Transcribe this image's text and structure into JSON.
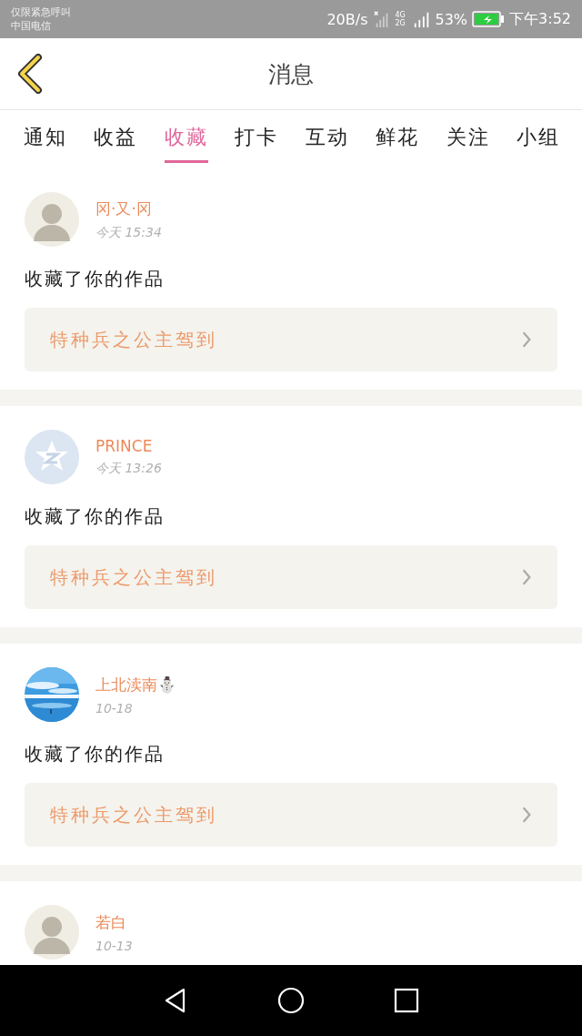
{
  "status_bar": {
    "notice": "仅限紧急呼叫",
    "carrier": "中国电信",
    "speed": "20B/s",
    "network": "4G 2G",
    "battery_text": "53%",
    "time": "下午3:52"
  },
  "header": {
    "title": "消息"
  },
  "tabs": [
    {
      "label": "通知",
      "selected": false
    },
    {
      "label": "收益",
      "selected": false
    },
    {
      "label": "收藏",
      "selected": true
    },
    {
      "label": "打卡",
      "selected": false
    },
    {
      "label": "互动",
      "selected": false
    },
    {
      "label": "鲜花",
      "selected": false
    },
    {
      "label": "关注",
      "selected": false
    },
    {
      "label": "小组",
      "selected": false
    }
  ],
  "messages": [
    {
      "kind": "figure",
      "name": "冈·又·冈",
      "time": "今天 15:34",
      "action": "收藏了你的作品",
      "work": "特种兵之公主驾到"
    },
    {
      "kind": "logo",
      "name": "PRINCE",
      "time": "今天 13:26",
      "action": "收藏了你的作品",
      "work": "特种兵之公主驾到"
    },
    {
      "kind": "picture",
      "name": "上北渎南⛄",
      "time": "10-18",
      "action": "收藏了你的作品",
      "work": "特种兵之公主驾到"
    },
    {
      "kind": "figure",
      "name": "若白",
      "time": "10-13"
    }
  ]
}
